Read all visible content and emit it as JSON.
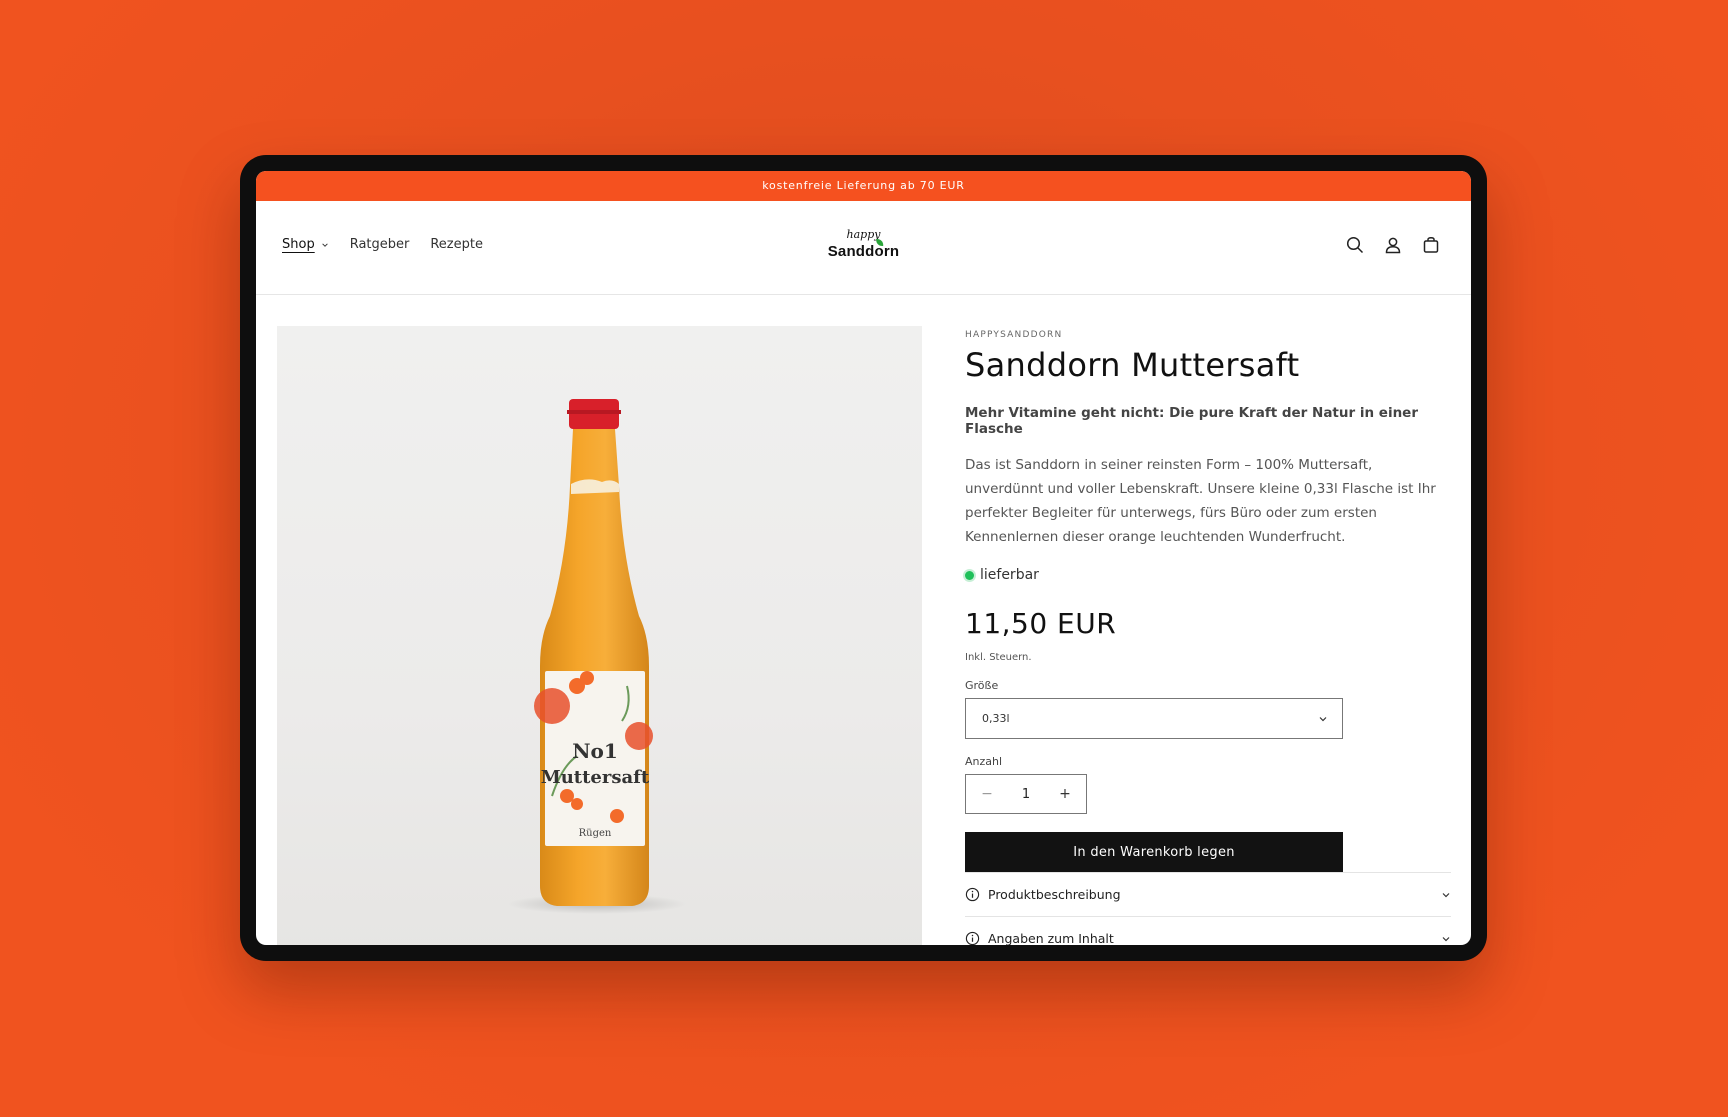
{
  "announcement": "kostenfreie Lieferung ab 70 EUR",
  "nav": {
    "items": [
      {
        "label": "Shop",
        "active": true,
        "has_dropdown": true
      },
      {
        "label": "Ratgeber"
      },
      {
        "label": "Rezepte"
      }
    ]
  },
  "logo": {
    "top": "happy",
    "brand": "Sanddorn"
  },
  "header_icons": [
    "search-icon",
    "account-icon",
    "cart-icon"
  ],
  "product": {
    "image_label": {
      "no": "No1",
      "name": "Muttersaft",
      "origin": "Rügen"
    },
    "vendor": "HAPPYSANDDORN",
    "title": "Sanddorn Muttersaft",
    "subtitle": "Mehr Vitamine geht nicht: Die pure Kraft der Natur in einer Flasche",
    "description": "Das ist Sanddorn in seiner reinsten Form – 100% Muttersaft, unverdünnt und voller Lebenskraft. Unsere kleine 0,33l Flasche ist Ihr perfekter Begleiter für unterwegs, fürs Büro oder zum ersten Kennenlernen dieser orange leuchtenden Wunderfrucht.",
    "stock": "lieferbar",
    "price": "11,50 EUR",
    "tax_note": "Inkl. Steuern.",
    "size_label": "Größe",
    "size_value": "0,33l",
    "qty_label": "Anzahl",
    "qty_value": "1",
    "add_to_cart": "In den Warenkorb legen",
    "accordions": [
      "Produktbeschreibung",
      "Angaben zum Inhalt"
    ]
  },
  "colors": {
    "accent": "#f5511f",
    "stock_green": "#1fc05a",
    "button": "#121212"
  }
}
